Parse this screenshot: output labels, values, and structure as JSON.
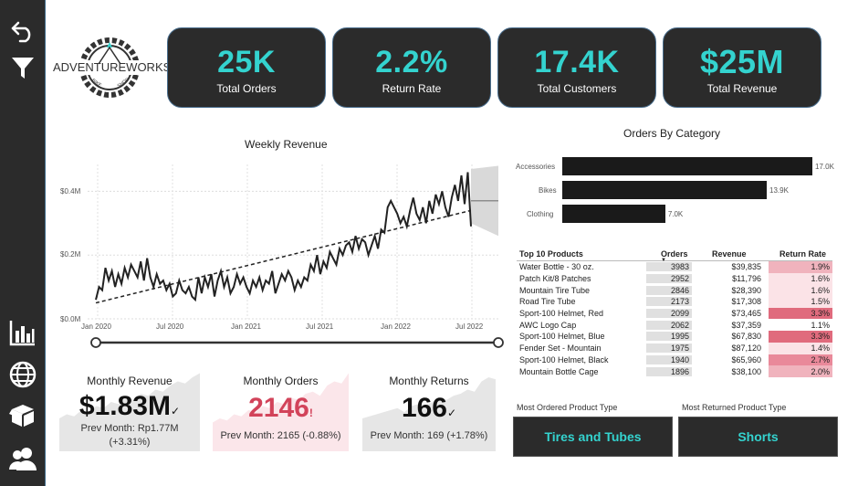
{
  "kpis": [
    {
      "value": "25K",
      "label": "Total Orders"
    },
    {
      "value": "2.2%",
      "label": "Return Rate"
    },
    {
      "value": "17.4K",
      "label": "Total Customers"
    },
    {
      "value": "$25M",
      "label": "Total Revenue"
    }
  ],
  "logo": {
    "brand": "ADVENTUREWORKS",
    "sub_left": "BIKE",
    "sub_right": "SHOP"
  },
  "colors": {
    "accent": "#34d3cf",
    "tile_bg": "#2b2b2b",
    "danger": "#d2435a",
    "rate_high": "#e06b7d",
    "rate_mid": "#f0b3bd",
    "rate_low": "#fbe3e7"
  },
  "weekly_revenue": {
    "title": "Weekly Revenue",
    "y_ticks": [
      "$0.4M",
      "$0.2M",
      "$0.0M"
    ],
    "x_ticks": [
      "Jan 2020",
      "Jul 2020",
      "Jan 2021",
      "Jul 2021",
      "Jan 2022",
      "Jul 2022"
    ]
  },
  "orders_by_category": {
    "title": "Orders By Category",
    "items": [
      {
        "label": "Accessories",
        "value": "17.0K"
      },
      {
        "label": "Bikes",
        "value": "13.9K"
      },
      {
        "label": "Clothing",
        "value": "7.0K"
      }
    ]
  },
  "chart_data": [
    {
      "type": "line",
      "title": "Weekly Revenue",
      "xlabel": "",
      "ylabel": "",
      "x_range": [
        "Jan 2020",
        "Jul 2022"
      ],
      "ylim": [
        0,
        0.47
      ],
      "y_unit": "$M",
      "y_values": [
        0.06,
        0.1,
        0.09,
        0.16,
        0.12,
        0.15,
        0.1,
        0.14,
        0.11,
        0.16,
        0.13,
        0.17,
        0.15,
        0.13,
        0.18,
        0.12,
        0.19,
        0.13,
        0.1,
        0.14,
        0.11,
        0.12,
        0.09,
        0.11,
        0.07,
        0.08,
        0.12,
        0.09,
        0.08,
        0.1,
        0.07,
        0.06,
        0.13,
        0.08,
        0.13,
        0.1,
        0.14,
        0.07,
        0.12,
        0.15,
        0.1,
        0.13,
        0.08,
        0.1,
        0.14,
        0.11,
        0.13,
        0.1,
        0.08,
        0.12,
        0.1,
        0.13,
        0.09,
        0.12,
        0.11,
        0.15,
        0.08,
        0.11,
        0.14,
        0.12,
        0.15,
        0.13,
        0.09,
        0.12,
        0.1,
        0.13,
        0.12,
        0.17,
        0.15,
        0.2,
        0.14,
        0.18,
        0.16,
        0.21,
        0.19,
        0.17,
        0.22,
        0.2,
        0.23,
        0.24,
        0.21,
        0.26,
        0.22,
        0.25,
        0.24,
        0.2,
        0.23,
        0.26,
        0.22,
        0.28,
        0.27,
        0.35,
        0.37,
        0.35,
        0.33,
        0.3,
        0.32,
        0.29,
        0.34,
        0.38,
        0.33,
        0.31,
        0.35,
        0.3,
        0.37,
        0.33,
        0.39,
        0.36,
        0.4,
        0.35,
        0.32,
        0.38,
        0.42,
        0.37,
        0.45,
        0.36,
        0.46,
        0.29
      ],
      "trend": {
        "start": 0.05,
        "end": 0.34
      },
      "forecast_band": {
        "upper_start": 0.47,
        "lower_start": 0.3,
        "upper_end": 0.48,
        "lower_end": 0.26,
        "mid": 0.37
      }
    },
    {
      "type": "bar",
      "title": "Orders By Category",
      "categories": [
        "Accessories",
        "Bikes",
        "Clothing"
      ],
      "values": [
        17.0,
        13.9,
        7.0
      ],
      "unit": "K"
    },
    {
      "type": "area",
      "title": "Monthly Revenue",
      "values": [
        0.8,
        0.9,
        0.85,
        1.0,
        0.95,
        1.1,
        1.05,
        1.2,
        1.15,
        1.3,
        1.25,
        1.4,
        1.35,
        1.5,
        1.45,
        1.6,
        1.7,
        1.65,
        1.8,
        1.9
      ]
    },
    {
      "type": "area",
      "title": "Monthly Orders",
      "values": [
        0.7,
        0.8,
        0.75,
        0.9,
        0.85,
        1.0,
        0.95,
        1.1,
        1.05,
        1.2,
        1.15,
        1.3,
        1.25,
        1.4,
        1.45,
        1.35,
        1.6,
        1.7,
        1.65,
        1.9
      ]
    },
    {
      "type": "area",
      "title": "Monthly Returns",
      "values": [
        0.8,
        0.85,
        0.9,
        0.95,
        1.0,
        1.05,
        0.95,
        1.1,
        1.15,
        1.1,
        1.2,
        1.3,
        1.25,
        1.35,
        1.4,
        1.5,
        1.45,
        1.7,
        1.8,
        1.75
      ]
    }
  ],
  "monthly_revenue": {
    "title": "Monthly Revenue",
    "value": "$1.83M",
    "indicator": "✓",
    "prev_line1": "Prev Month: Rp1.77M",
    "prev_line2": "(+3.31%)"
  },
  "monthly_orders": {
    "title": "Monthly Orders",
    "value": "2146",
    "indicator": "!",
    "prev": "Prev Month: 2165 (-0.88%)"
  },
  "monthly_returns": {
    "title": "Monthly Returns",
    "value": "166",
    "indicator": "✓",
    "prev": "Prev Month: 169 (+1.78%)"
  },
  "top_products": {
    "headers": [
      "Top 10 Products",
      "Orders",
      "Revenue",
      "Return Rate"
    ],
    "rows": [
      {
        "name": "Water Bottle - 30 oz.",
        "orders": "3983",
        "revenue": "$39,835",
        "rate": "1.9%",
        "level": "mid"
      },
      {
        "name": "Patch Kit/8 Patches",
        "orders": "2952",
        "revenue": "$11,796",
        "rate": "1.6%",
        "level": "low"
      },
      {
        "name": "Mountain Tire Tube",
        "orders": "2846",
        "revenue": "$28,390",
        "rate": "1.6%",
        "level": "low"
      },
      {
        "name": "Road Tire Tube",
        "orders": "2173",
        "revenue": "$17,308",
        "rate": "1.5%",
        "level": "low"
      },
      {
        "name": "Sport-100 Helmet, Red",
        "orders": "2099",
        "revenue": "$73,465",
        "rate": "3.3%",
        "level": "high"
      },
      {
        "name": "AWC Logo Cap",
        "orders": "2062",
        "revenue": "$37,359",
        "rate": "1.1%",
        "level": "none"
      },
      {
        "name": "Sport-100 Helmet, Blue",
        "orders": "1995",
        "revenue": "$67,830",
        "rate": "3.3%",
        "level": "high"
      },
      {
        "name": "Fender Set - Mountain",
        "orders": "1975",
        "revenue": "$87,120",
        "rate": "1.4%",
        "level": "low"
      },
      {
        "name": "Sport-100 Helmet, Black",
        "orders": "1940",
        "revenue": "$65,960",
        "rate": "2.7%",
        "level": "midhigh"
      },
      {
        "name": "Mountain Bottle Cage",
        "orders": "1896",
        "revenue": "$38,100",
        "rate": "2.0%",
        "level": "mid"
      }
    ]
  },
  "product_types": {
    "most_ordered_label": "Most Ordered Product Type",
    "most_ordered_value": "Tires and Tubes",
    "most_returned_label": "Most Returned Product Type",
    "most_returned_value": "Shorts"
  }
}
